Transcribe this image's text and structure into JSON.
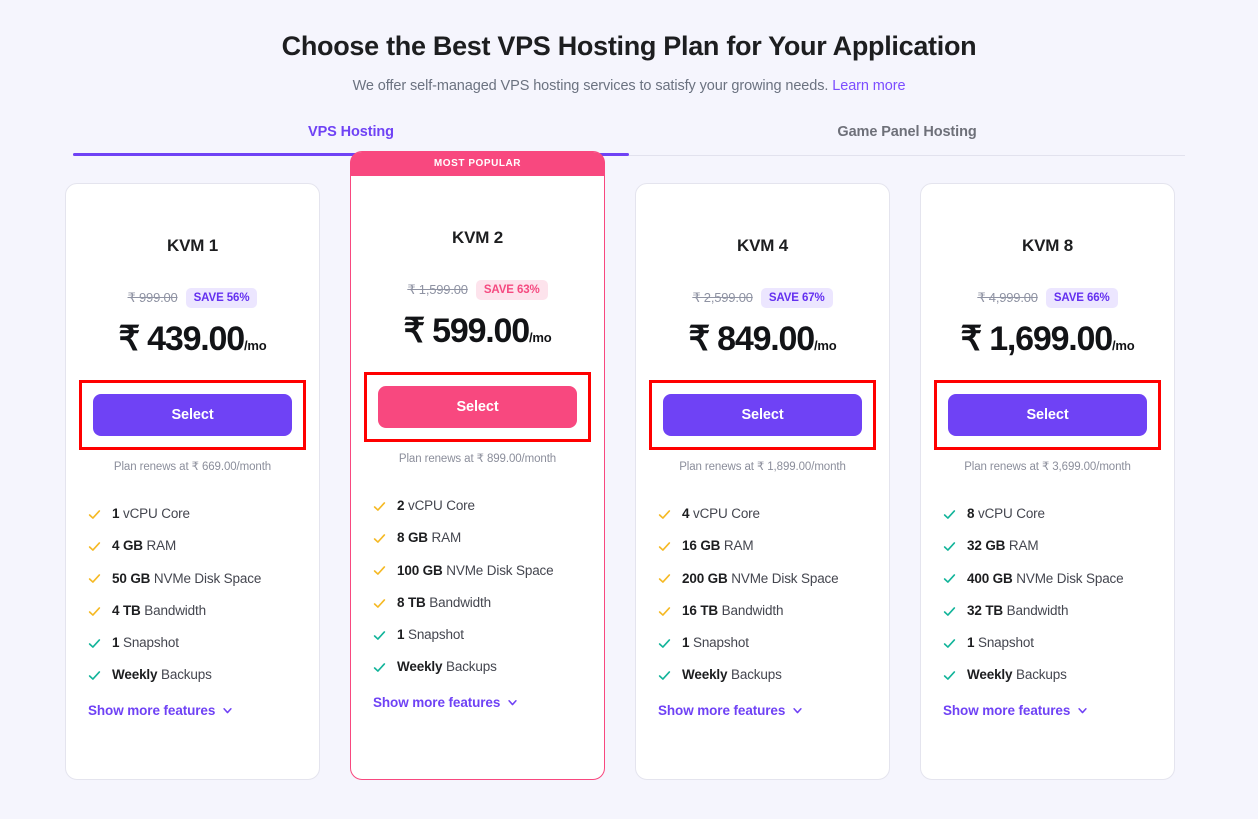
{
  "header": {
    "title": "Choose the Best VPS Hosting Plan for Your Application",
    "subtitle_text": "We offer self-managed VPS hosting services to satisfy your growing needs.",
    "learn_more_label": "Learn more"
  },
  "tabs": [
    {
      "label": "VPS Hosting",
      "active": true
    },
    {
      "label": "Game Panel Hosting",
      "active": false
    }
  ],
  "colors": {
    "page_background": "#f5f5fd",
    "accent_purple": "#6f42f5",
    "accent_pink": "#f8487f",
    "check_amber": "#f5b924",
    "check_teal": "#12b49a",
    "annotation_red": "#ff0000",
    "muted_text": "#8b8e9b"
  },
  "icons": {
    "check": "check-icon",
    "chevron_down": "chevron-down-icon"
  },
  "common": {
    "select_label": "Select",
    "show_more_label": "Show more features",
    "popular_badge_label": "MOST POPULAR",
    "per_period": "/mo"
  },
  "plans": [
    {
      "name": "KVM 1",
      "popular": false,
      "old_price": "₹ 999.00",
      "save_badge": "SAVE 56%",
      "price": "₹ 439.00",
      "per": "/mo",
      "renew_note": "Plan renews at ₹ 669.00/month",
      "select_label": "Select",
      "show_more_label": "Show more features",
      "features": [
        {
          "value": "1",
          "label": "vCPU Core",
          "check_color": "#f5b924"
        },
        {
          "value": "4 GB",
          "label": "RAM",
          "check_color": "#f5b924"
        },
        {
          "value": "50 GB",
          "label": "NVMe Disk Space",
          "check_color": "#f5b924"
        },
        {
          "value": "4 TB",
          "label": "Bandwidth",
          "check_color": "#f5b924"
        },
        {
          "value": "1",
          "label": "Snapshot",
          "check_color": "#12b49a"
        },
        {
          "value": "Weekly",
          "label": "Backups",
          "check_color": "#12b49a"
        }
      ]
    },
    {
      "name": "KVM 2",
      "popular": true,
      "popular_badge": "MOST POPULAR",
      "old_price": "₹ 1,599.00",
      "save_badge": "SAVE 63%",
      "price": "₹ 599.00",
      "per": "/mo",
      "renew_note": "Plan renews at ₹ 899.00/month",
      "select_label": "Select",
      "show_more_label": "Show more features",
      "features": [
        {
          "value": "2",
          "label": "vCPU Core",
          "check_color": "#f5b924"
        },
        {
          "value": "8 GB",
          "label": "RAM",
          "check_color": "#f5b924"
        },
        {
          "value": "100 GB",
          "label": "NVMe Disk Space",
          "check_color": "#f5b924"
        },
        {
          "value": "8 TB",
          "label": "Bandwidth",
          "check_color": "#f5b924"
        },
        {
          "value": "1",
          "label": "Snapshot",
          "check_color": "#12b49a"
        },
        {
          "value": "Weekly",
          "label": "Backups",
          "check_color": "#12b49a"
        }
      ]
    },
    {
      "name": "KVM 4",
      "popular": false,
      "old_price": "₹ 2,599.00",
      "save_badge": "SAVE 67%",
      "price": "₹ 849.00",
      "per": "/mo",
      "renew_note": "Plan renews at ₹ 1,899.00/month",
      "select_label": "Select",
      "show_more_label": "Show more features",
      "features": [
        {
          "value": "4",
          "label": "vCPU Core",
          "check_color": "#f5b924"
        },
        {
          "value": "16 GB",
          "label": "RAM",
          "check_color": "#f5b924"
        },
        {
          "value": "200 GB",
          "label": "NVMe Disk Space",
          "check_color": "#f5b924"
        },
        {
          "value": "16 TB",
          "label": "Bandwidth",
          "check_color": "#f5b924"
        },
        {
          "value": "1",
          "label": "Snapshot",
          "check_color": "#12b49a"
        },
        {
          "value": "Weekly",
          "label": "Backups",
          "check_color": "#12b49a"
        }
      ]
    },
    {
      "name": "KVM 8",
      "popular": false,
      "old_price": "₹ 4,999.00",
      "save_badge": "SAVE 66%",
      "price": "₹ 1,699.00",
      "per": "/mo",
      "renew_note": "Plan renews at ₹ 3,699.00/month",
      "select_label": "Select",
      "show_more_label": "Show more features",
      "features": [
        {
          "value": "8",
          "label": "vCPU Core",
          "check_color": "#12b49a"
        },
        {
          "value": "32 GB",
          "label": "RAM",
          "check_color": "#12b49a"
        },
        {
          "value": "400 GB",
          "label": "NVMe Disk Space",
          "check_color": "#12b49a"
        },
        {
          "value": "32 TB",
          "label": "Bandwidth",
          "check_color": "#12b49a"
        },
        {
          "value": "1",
          "label": "Snapshot",
          "check_color": "#12b49a"
        },
        {
          "value": "Weekly",
          "label": "Backups",
          "check_color": "#12b49a"
        }
      ]
    }
  ]
}
